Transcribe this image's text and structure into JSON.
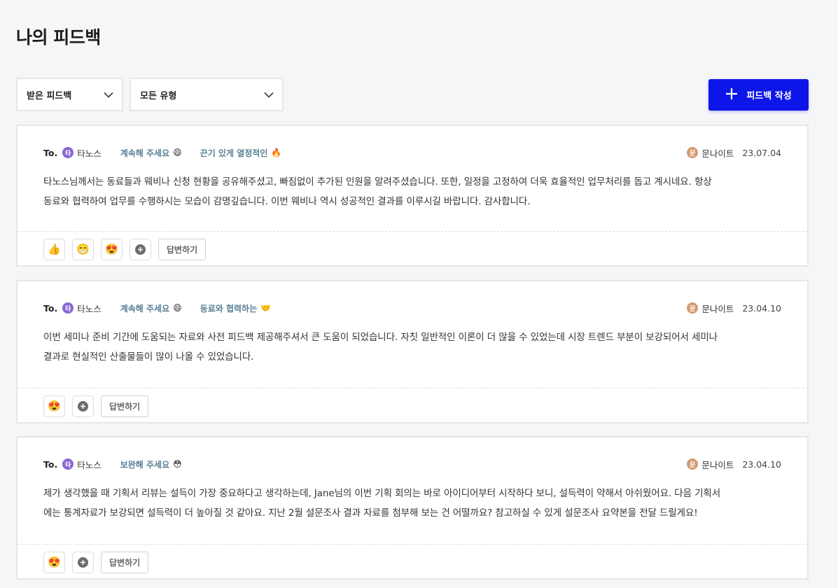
{
  "page": {
    "title": "나의 피드백"
  },
  "filters": {
    "direction": {
      "selected": "받은 피드백"
    },
    "type": {
      "selected": "모든 유형"
    }
  },
  "write_button": {
    "label": "피드백 작성",
    "icon": "plus-icon"
  },
  "colors": {
    "accent": "#0d16e8",
    "tag_text": "#5a7f96",
    "avatar_recipient": "#8b67d4",
    "avatar_author": "#d49a72"
  },
  "feedbacks": [
    {
      "to_label": "To.",
      "recipient": {
        "initial": "타",
        "name": "타노스"
      },
      "tags": [
        {
          "label": "계속해 주세요",
          "emoji": "😄"
        },
        {
          "label": "끈기 있게 열정적인",
          "emoji": "🔥"
        }
      ],
      "author": {
        "initial": "문",
        "name": "문나이트"
      },
      "date": "23.07.04",
      "body_lines": [
        "타노스님께서는 동료들과 웨비나 신청 현황을 공유해주셨고, 빠짐없이 추가된 인원을 알려주셨습니다. 또한, 일정을 고정하여 더욱 효율적인 업무처리를 돕고 계시네요. 항상",
        "동료와 협력하여 업무를 수행하시는 모습이 감명깊습니다. 이번 웨비나 역시 성공적인 결과를 이루시길 바랍니다. 감사합니다."
      ],
      "reactions": [
        "👍",
        "😁",
        "😍"
      ],
      "reply_label": "답변하기"
    },
    {
      "to_label": "To.",
      "recipient": {
        "initial": "타",
        "name": "타노스"
      },
      "tags": [
        {
          "label": "계속해 주세요",
          "emoji": "😄"
        },
        {
          "label": "동료와 협력하는",
          "emoji": "🤝"
        }
      ],
      "author": {
        "initial": "문",
        "name": "문나이트"
      },
      "date": "23.04.10",
      "body_lines": [
        "이번 세미나 준비 기간에 도움되는 자료와 사전 피드백 제공해주셔서 큰 도움이 되었습니다. 자칫 일반적인 이론이 더 많을 수 있었는데 시장 트렌드 부분이 보강되어서 세미나",
        "결과로 현실적인 산출물들이 많이 나올 수 있었습니다."
      ],
      "reactions": [
        "😍"
      ],
      "reply_label": "답변하기"
    },
    {
      "to_label": "To.",
      "recipient": {
        "initial": "타",
        "name": "타노스"
      },
      "tags": [
        {
          "label": "보완해 주세요",
          "emoji": "😳"
        }
      ],
      "author": {
        "initial": "문",
        "name": "문나이트"
      },
      "date": "23.04.10",
      "body_lines": [
        "제가 생각했을 때 기획서 리뷰는 설득이 가장 중요하다고 생각하는데, Jane님의 이번 기획 회의는 바로 아이디어부터 시작하다 보니, 설득력이 약해서 아쉬웠어요. 다음 기획서",
        "에는 통계자료가 보강되면 설득력이 더 높아질 것 같아요. 지난 2월 설문조사 결과 자료를 첨부해 보는 건 어떨까요? 참고하실 수 있게 설문조사 요약본을 전달 드릴게요!"
      ],
      "reactions": [
        "😍"
      ],
      "reply_label": "답변하기"
    }
  ]
}
